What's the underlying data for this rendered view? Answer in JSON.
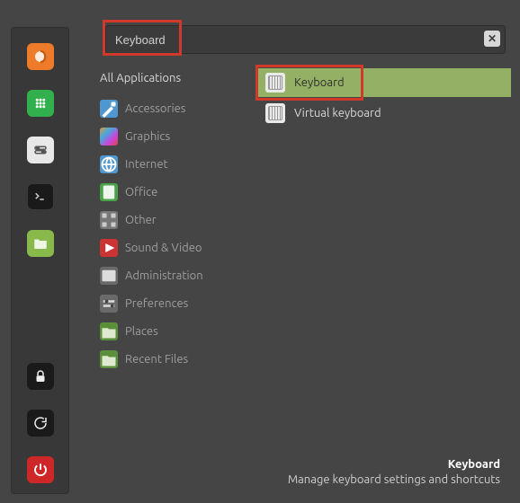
{
  "search": {
    "value": "Keyboard"
  },
  "categories": {
    "header": "All Applications",
    "items": [
      {
        "label": "Accessories",
        "icon": "accessories"
      },
      {
        "label": "Graphics",
        "icon": "graphics"
      },
      {
        "label": "Internet",
        "icon": "internet"
      },
      {
        "label": "Office",
        "icon": "office"
      },
      {
        "label": "Other",
        "icon": "other"
      },
      {
        "label": "Sound & Video",
        "icon": "sound-video"
      },
      {
        "label": "Administration",
        "icon": "administration"
      },
      {
        "label": "Preferences",
        "icon": "preferences"
      },
      {
        "label": "Places",
        "icon": "places"
      },
      {
        "label": "Recent Files",
        "icon": "recent-files"
      }
    ]
  },
  "results": [
    {
      "label": "Keyboard",
      "icon": "keyboard",
      "selected": true
    },
    {
      "label": "Virtual keyboard",
      "icon": "virtual-keyboard",
      "selected": false
    }
  ],
  "footer": {
    "title": "Keyboard",
    "description": "Manage keyboard settings and shortcuts"
  },
  "launcher": [
    {
      "name": "firefox"
    },
    {
      "name": "applications"
    },
    {
      "name": "settings-toggle"
    },
    {
      "name": "terminal"
    },
    {
      "name": "files"
    },
    {
      "name": "lock"
    },
    {
      "name": "refresh-logout"
    },
    {
      "name": "power"
    }
  ]
}
